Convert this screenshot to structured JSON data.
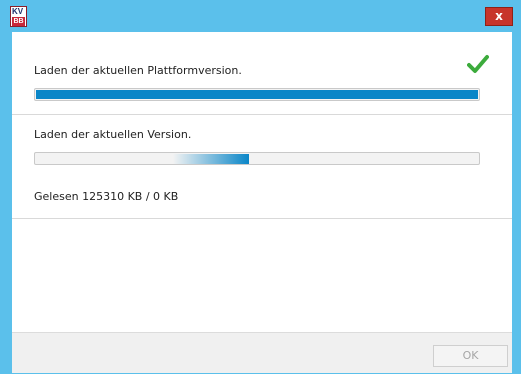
{
  "window": {
    "logo_text_top": "KV",
    "logo_text_bottom": "BB",
    "close_glyph": "x"
  },
  "task1": {
    "label": "Laden der aktuellen Plattformversion.",
    "progress": 1.0,
    "status_icon": "checkmark-icon"
  },
  "task2": {
    "label": "Laden der aktuellen Version.",
    "progress_style": "indeterminate-marquee"
  },
  "status": {
    "text": "Gelesen 125310 KB / 0 KB"
  },
  "footer": {
    "ok_label": "OK",
    "ok_enabled": false
  },
  "colors": {
    "titlebar": "#5bc0eb",
    "progress_fill": "#0a86c8",
    "close_button": "#c7352b",
    "check_green": "#3cab3c"
  }
}
